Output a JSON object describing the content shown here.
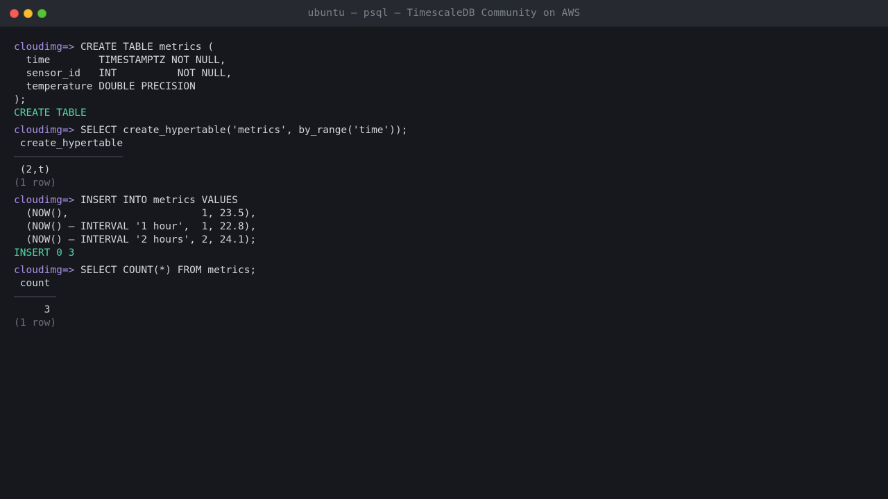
{
  "window": {
    "title": "ubuntu — psql — TimescaleDB Community on AWS",
    "colors": {
      "close": "#f25f58",
      "minimize": "#f9bc2e",
      "maximize": "#5ac335"
    }
  },
  "terminal": {
    "prompt": "cloudimg=>",
    "colors": {
      "prompt": "#a88ee8",
      "success": "#55d6a4",
      "muted": "#6b6f78",
      "text": "#d4d6dc"
    },
    "block1": {
      "cmd": " CREATE TABLE metrics (",
      "l1": "  time        TIMESTAMPTZ NOT NULL,",
      "l2": "  sensor_id   INT          NOT NULL,",
      "l3": "  temperature DOUBLE PRECISION",
      "l4": ");",
      "result": "CREATE TABLE"
    },
    "block2": {
      "cmd": " SELECT create_hypertable('metrics', by_range('time'));",
      "header": " create_hypertable",
      "separator": "——————————————————",
      "value": " (2,t)",
      "rows": "(1 row)"
    },
    "block3": {
      "cmd": " INSERT INTO metrics VALUES",
      "l1": "  (NOW(),                      1, 23.5),",
      "l2": "  (NOW() — INTERVAL '1 hour',  1, 22.8),",
      "l3": "  (NOW() — INTERVAL '2 hours', 2, 24.1);",
      "result": "INSERT 0 3"
    },
    "block4": {
      "cmd": " SELECT COUNT(*) FROM metrics;",
      "header": " count",
      "separator": "———————",
      "value": "     3",
      "rows": "(1 row)"
    }
  }
}
